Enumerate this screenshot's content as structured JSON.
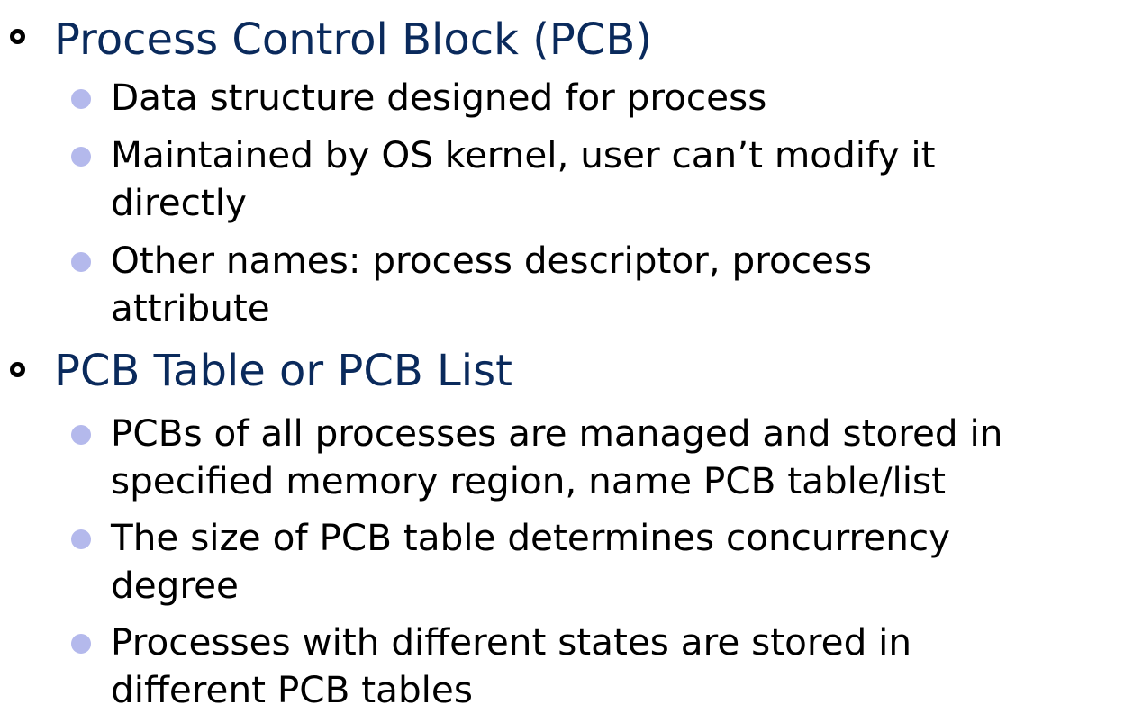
{
  "sections": [
    {
      "heading": "Process Control Block (PCB)",
      "items": [
        {
          "line1": "Data structure designed for process",
          "line2": ""
        },
        {
          "line1": "Maintained by OS kernel, user can’t modify it",
          "line2": "directly"
        },
        {
          "line1": "Other names: process descriptor, process",
          "line2": "attribute"
        }
      ]
    },
    {
      "heading": "PCB Table or PCB List",
      "items": [
        {
          "line1": "PCBs of all processes are managed and stored in",
          "line2": "specified memory region, name PCB table/list"
        },
        {
          "line1": "The size of PCB table determines concurrency",
          "line2": "degree"
        },
        {
          "line1": "Processes with different states are stored in",
          "line2": "different PCB tables"
        }
      ]
    }
  ],
  "colors": {
    "heading": "#0a2a5c",
    "body_text": "#000000",
    "sub_bullet": "#b4b9ec",
    "main_bullet": "#000000"
  }
}
